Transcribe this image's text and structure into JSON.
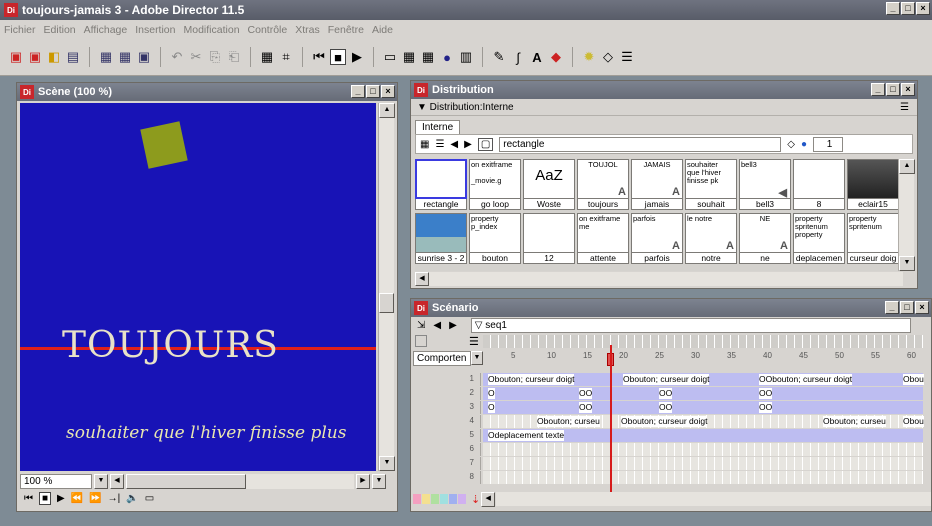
{
  "app": {
    "title": "toujours-jamais 3 - Adobe Director 11.5",
    "icon": "Di"
  },
  "menu": [
    "Fichier",
    "Edition",
    "Affichage",
    "Insertion",
    "Modification",
    "Contrôle",
    "Xtras",
    "Fenêtre",
    "Aide"
  ],
  "scene": {
    "title": "Scène (100 %)",
    "text_big": "TOUJOURS",
    "text_small": "souhaiter que l'hiver finisse plus",
    "zoom": "100 %"
  },
  "distribution": {
    "title": "Distribution",
    "panel_label": "▼ Distribution:Interne",
    "tab": "Interne",
    "member_name": "rectangle",
    "member_number": "1",
    "cast": [
      {
        "name": "rectangle",
        "thumb": ""
      },
      {
        "name": "go loop",
        "thumb": "on exitframe\n\n_movie.g"
      },
      {
        "name": "Woste",
        "thumb": "AaZ"
      },
      {
        "name": "toujours",
        "thumb": "TOUJOL"
      },
      {
        "name": "jamais",
        "thumb": "JAMAIS"
      },
      {
        "name": "souhait",
        "thumb": "souhaiter\nque l'hiver\nfinisse pk"
      },
      {
        "name": "bell3",
        "thumb": "bell3"
      },
      {
        "name": "8",
        "thumb": ""
      },
      {
        "name": "eclair15",
        "thumb": ""
      },
      {
        "name": "sunrise 3 - 2",
        "thumb": ""
      },
      {
        "name": "bouton",
        "thumb": "property\np_index"
      },
      {
        "name": "12",
        "thumb": ""
      },
      {
        "name": "attente",
        "thumb": "on exitframe\nme"
      },
      {
        "name": "parfois",
        "thumb": "parfois"
      },
      {
        "name": "notre",
        "thumb": "le notre"
      },
      {
        "name": "ne",
        "thumb": "NE"
      },
      {
        "name": "deplacemen",
        "thumb": "property\nspritenum\nproperty"
      },
      {
        "name": "curseur doig",
        "thumb": "property\nspritenum"
      }
    ]
  },
  "score": {
    "title": "Scénario",
    "marker": "seq1",
    "behavior": "Comporten",
    "frame_numbers": [
      "5",
      "10",
      "15",
      "20",
      "25",
      "30",
      "35",
      "40",
      "45",
      "50",
      "55",
      "60"
    ],
    "channels": [
      "1",
      "2",
      "3",
      "4",
      "5",
      "6",
      "7",
      "8"
    ],
    "sprites": [
      [
        "Obouton; curseur doigt",
        "Obouton; curseur doigt",
        "OObouton; curseur doigt",
        "Obou"
      ],
      [
        "O",
        "OO",
        "OO",
        "OO"
      ],
      [
        "O",
        "OO",
        "OO",
        "OO"
      ],
      [
        "Obouton; curseu",
        "Obouton; curseur doigt",
        "Obouton; curseu",
        "Obou"
      ],
      [
        "Odeplacement texte"
      ]
    ]
  }
}
